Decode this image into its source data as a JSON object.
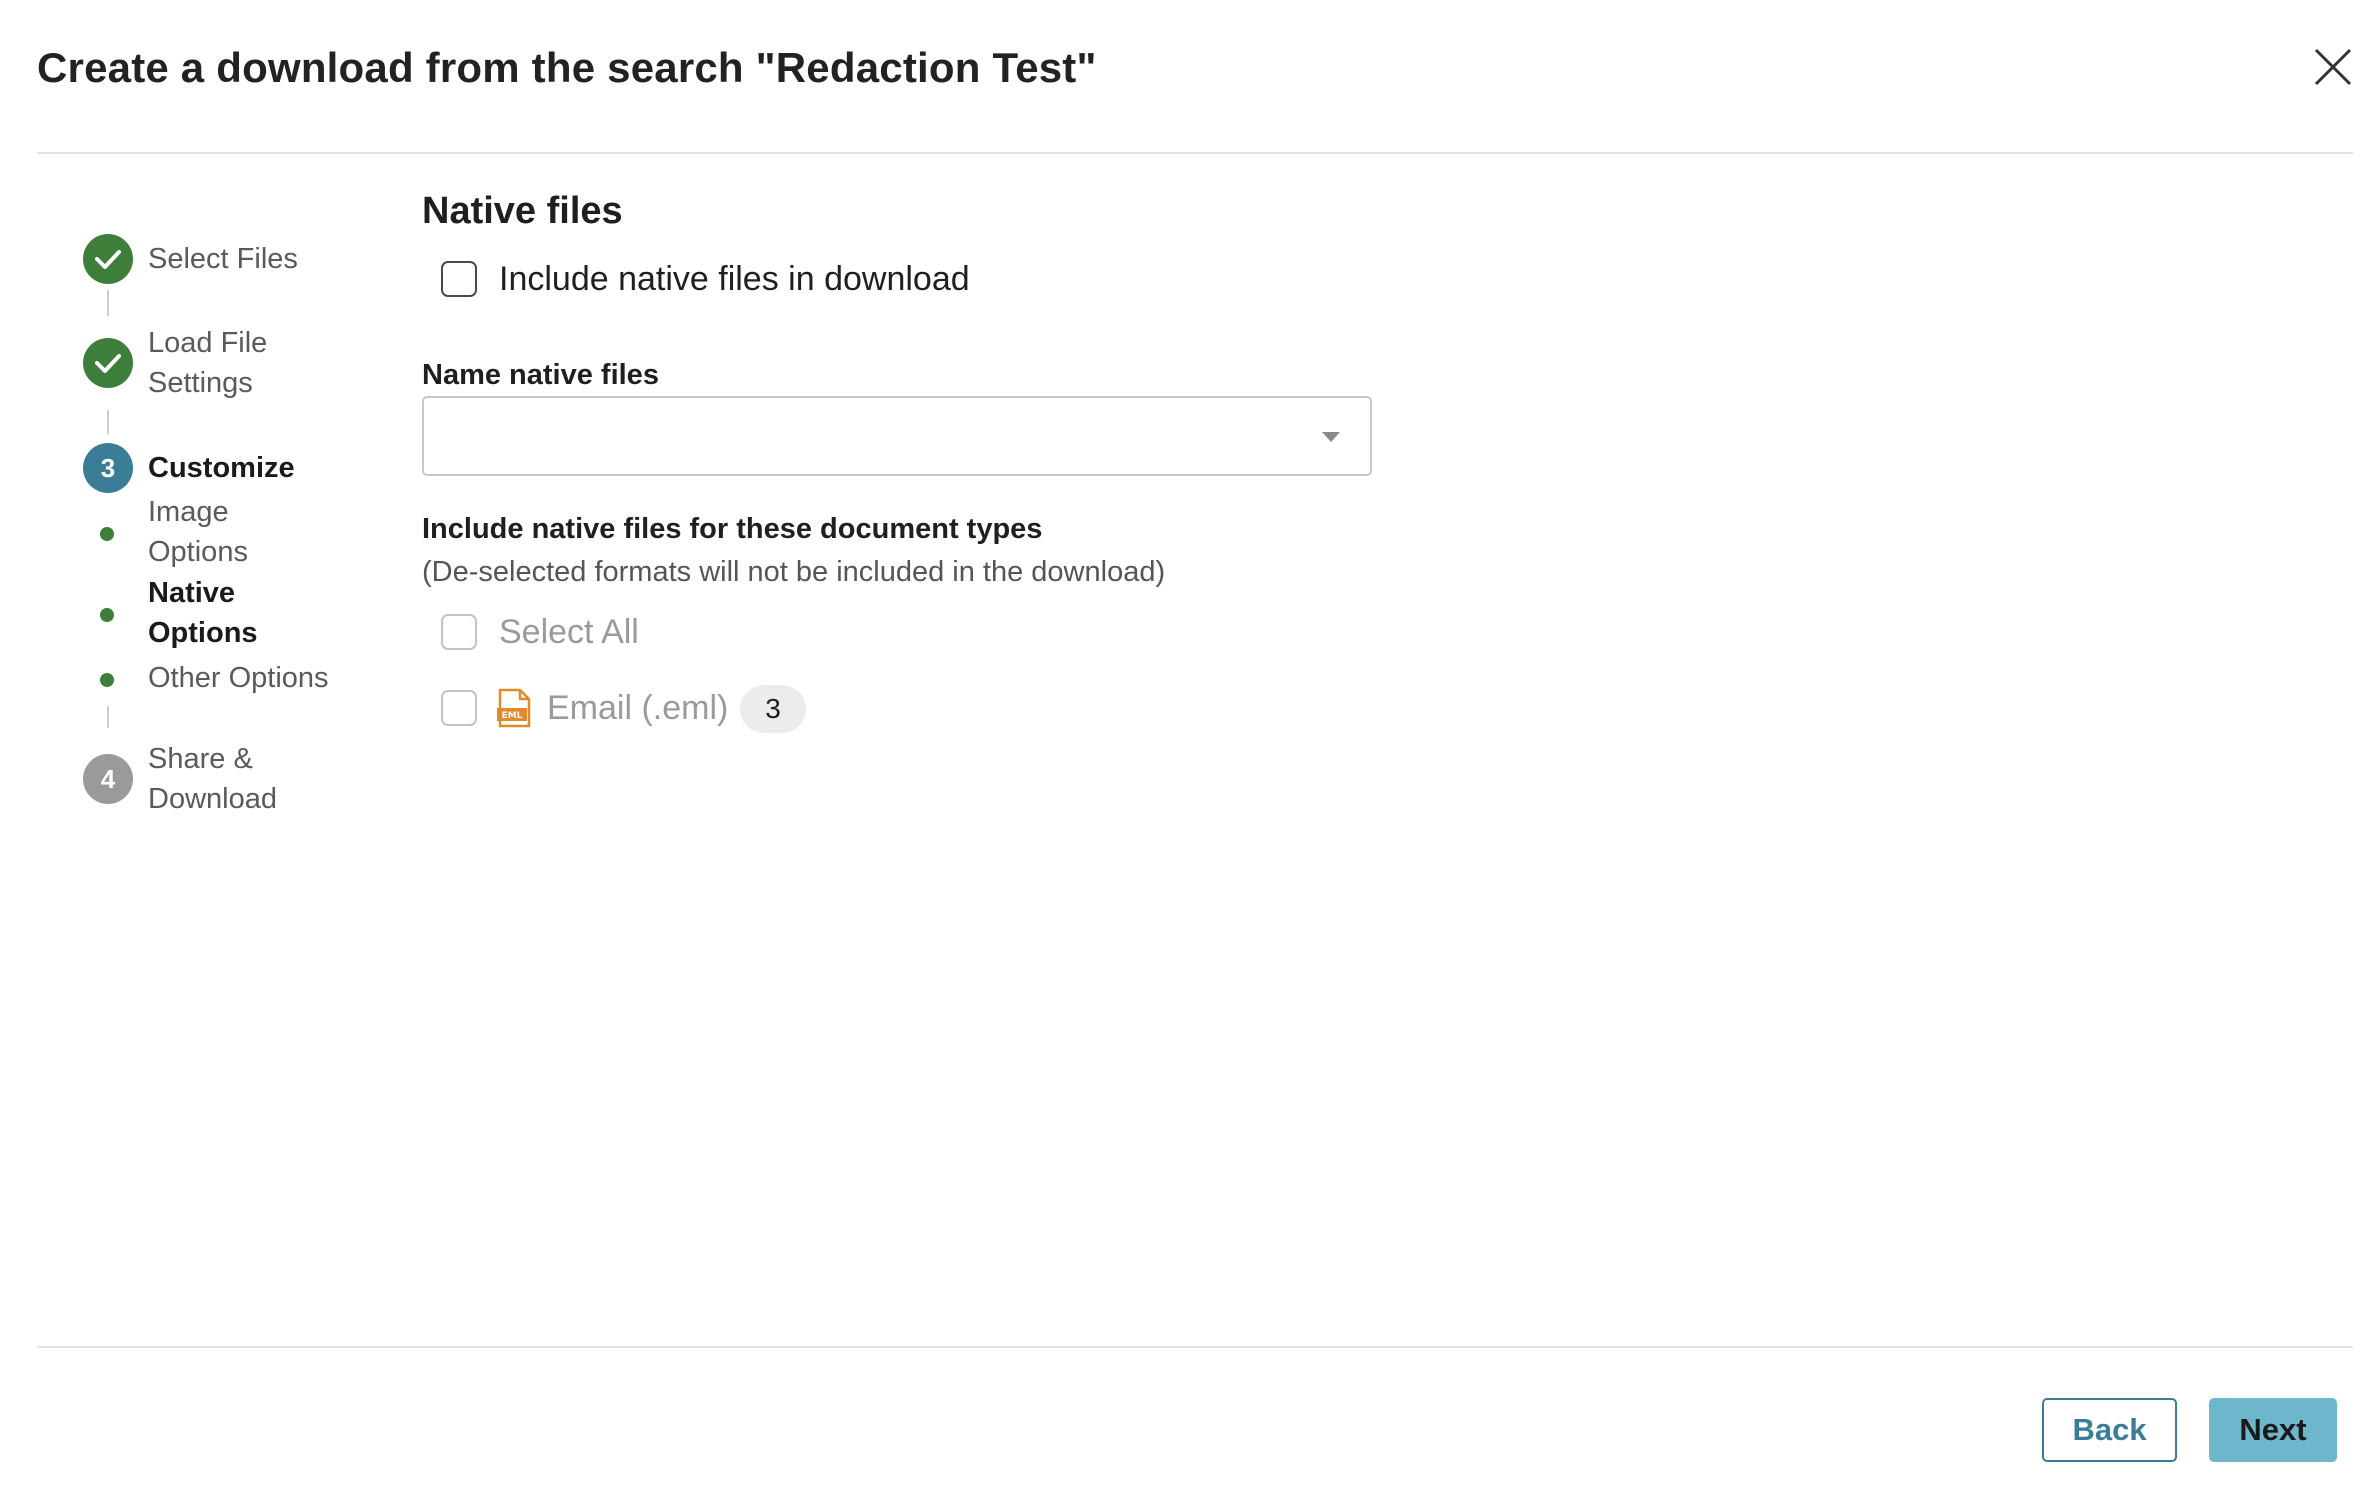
{
  "dialog": {
    "title": "Create a download from the search \"Redaction Test\""
  },
  "stepper": {
    "steps": [
      {
        "number": "1",
        "label": "Select Files",
        "state": "done"
      },
      {
        "number": "2",
        "label": "Load File Settings",
        "state": "done"
      },
      {
        "number": "3",
        "label": "Customize",
        "state": "active"
      },
      {
        "number": "4",
        "label": "Share & Download",
        "state": "pending"
      }
    ],
    "substeps": [
      {
        "label": "Image Options",
        "current": false
      },
      {
        "label": "Native Options",
        "current": true
      },
      {
        "label": "Other Options",
        "current": false
      }
    ]
  },
  "main": {
    "section_title": "Native files",
    "include_native": {
      "label": "Include native files in download",
      "checked": false
    },
    "name_native": {
      "label": "Name native files",
      "value": ""
    },
    "doc_types": {
      "label": "Include native files for these document types",
      "helper": "(De-selected formats will not be included in the download)",
      "select_all_label": "Select All",
      "items": [
        {
          "label": "Email (.eml)",
          "count": "3",
          "icon": "eml-file-icon",
          "checked": false
        }
      ]
    }
  },
  "footer": {
    "back_label": "Back",
    "next_label": "Next"
  },
  "colors": {
    "done": "#3d7f3a",
    "active": "#3b7d96",
    "pending": "#9a9a9a",
    "next_button": "#6db6cc"
  }
}
